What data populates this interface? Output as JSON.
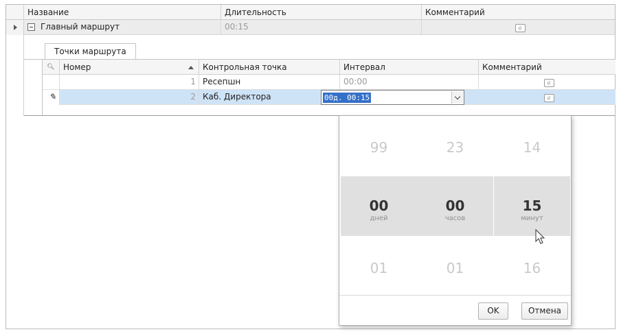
{
  "master": {
    "columns": [
      "Название",
      "Длительность",
      "Комментарий"
    ],
    "row": {
      "name": "Главный маршрут",
      "duration": "00:15",
      "comment_icon": "memo-icon"
    }
  },
  "detail": {
    "tab": "Точки маршрута",
    "columns": [
      "Номер",
      "Контрольная точка",
      "Интервал",
      "Комментарий"
    ],
    "rows": [
      {
        "number": "1",
        "checkpoint": "Ресепшн",
        "interval": "00:00"
      },
      {
        "number": "2",
        "checkpoint": "Каб. Директора",
        "interval": "00д. 00:15"
      }
    ]
  },
  "picker": {
    "days": {
      "prev": "99",
      "value": "00",
      "next": "01",
      "unit": "дней"
    },
    "hours": {
      "prev": "23",
      "value": "00",
      "next": "01",
      "unit": "часов"
    },
    "minutes": {
      "prev": "14",
      "value": "15",
      "next": "16",
      "unit": "минут"
    },
    "ok_label": "OK",
    "cancel_label": "Отмена"
  },
  "colors": {
    "selection": "#cfe3f7",
    "editor_highlight": "#3470c8"
  }
}
